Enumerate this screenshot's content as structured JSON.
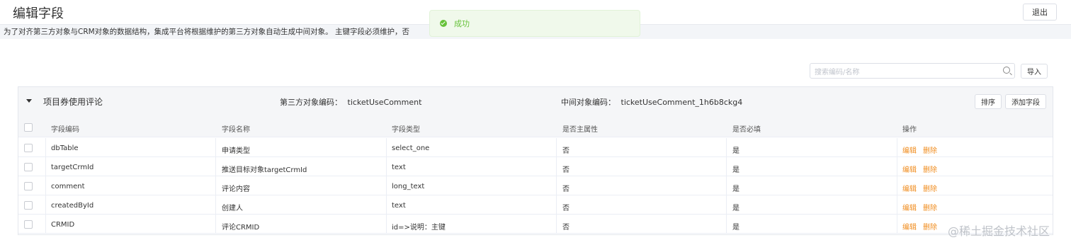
{
  "header": {
    "title": "编辑字段",
    "exit_label": "退出"
  },
  "notice": {
    "text": "为了对齐第三方对象与CRM对象的数据结构，集成平台将根据维护的第三方对象自动生成中间对象。 主键字段必须维护，否"
  },
  "toast": {
    "text": "成功",
    "type": "success",
    "color": "#67c23a"
  },
  "search": {
    "placeholder": "搜索编码/名称",
    "value": ""
  },
  "import_label": "导入",
  "object": {
    "name": "项目券使用评论",
    "third_code_label": "第三方对象编码：",
    "third_code": "ticketUseComment",
    "mid_code_label": "中间对象编码：",
    "mid_code": "ticketUseComment_1h6b8ckg4",
    "sort_label": "排序",
    "add_field_label": "添加字段"
  },
  "table": {
    "columns": [
      "字段编码",
      "字段名称",
      "字段类型",
      "是否主属性",
      "是否必填",
      "操作"
    ],
    "rows": [
      [
        "dbTable",
        "申请类型",
        "select_one",
        "否",
        "是"
      ],
      [
        "targetCrmId",
        "推送目标对象targetCrmId",
        "text",
        "否",
        "是"
      ],
      [
        "comment",
        "评论内容",
        "long_text",
        "否",
        "是"
      ],
      [
        "createdById",
        "创建人",
        "text",
        "否",
        "是"
      ],
      [
        "CRMID",
        "评论CRMID",
        "id=>说明：主键",
        "否",
        "是"
      ]
    ],
    "edit_label": "编辑",
    "delete_label": "删除",
    "action_color": "#f08c1e"
  },
  "watermark": "@稀土掘金技术社区"
}
